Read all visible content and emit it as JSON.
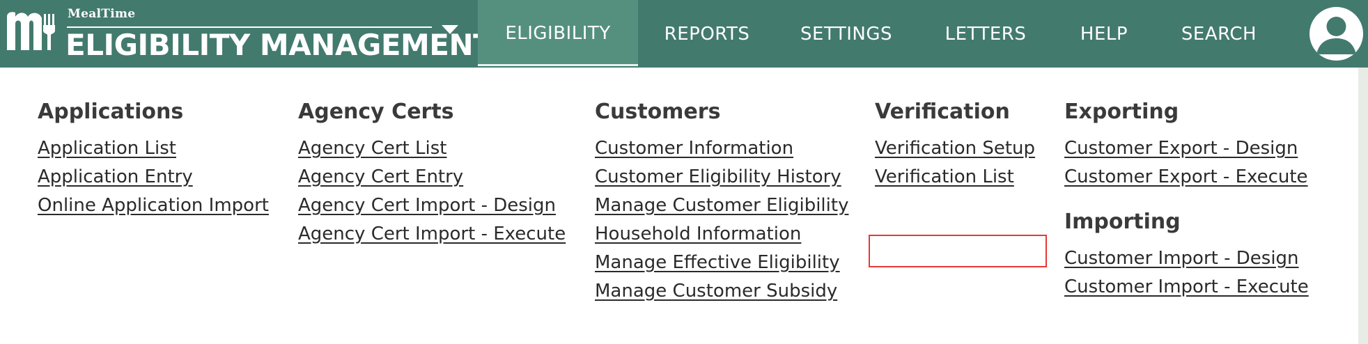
{
  "header": {
    "brand_small": "MealTime",
    "brand_title": "ELIGIBILITY MANAGEMENT",
    "logo_icon": "mealtime-m-fork-icon",
    "colors": {
      "bar": "#437a6e",
      "active_tab": "#55907f",
      "highlight": "#e53935"
    }
  },
  "nav": {
    "tabs": [
      {
        "label": "ELIGIBILITY",
        "active": true
      },
      {
        "label": "REPORTS"
      },
      {
        "label": "SETTINGS"
      },
      {
        "label": "LETTERS"
      },
      {
        "label": "HELP"
      },
      {
        "label": "SEARCH"
      }
    ],
    "avatar_icon": "user-avatar-icon"
  },
  "menu": {
    "applications": {
      "title": "Applications",
      "links": [
        "Application List",
        "Application Entry",
        "Online Application Import"
      ]
    },
    "agency_certs": {
      "title": "Agency Certs",
      "links": [
        "Agency Cert List",
        "Agency Cert Entry",
        "Agency Cert Import - Design",
        "Agency Cert Import - Execute"
      ]
    },
    "customers": {
      "title": "Customers",
      "links": [
        "Customer Information",
        "Customer Eligibility History",
        "Manage Customer Eligibility",
        "Household Information",
        "Manage Effective Eligibility",
        "Manage Customer Subsidy"
      ]
    },
    "verification": {
      "title": "Verification",
      "links": [
        "Verification Setup",
        "Verification List"
      ]
    },
    "exporting": {
      "title": "Exporting",
      "links": [
        "Customer Export - Design",
        "Customer Export - Execute"
      ]
    },
    "importing": {
      "title": "Importing",
      "links": [
        "Customer Import - Design",
        "Customer Import - Execute"
      ]
    }
  }
}
